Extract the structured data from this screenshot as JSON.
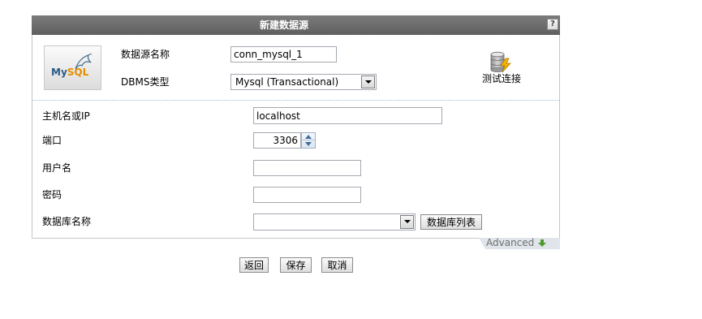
{
  "dialog": {
    "title": "新建数据源",
    "help_label": "?"
  },
  "logo": {
    "text_my": "My",
    "text_sql": "SQL"
  },
  "datasource": {
    "name_label": "数据源名称",
    "name_value": "conn_mysql_1",
    "dbms_label": "DBMS类型",
    "dbms_value": "Mysql (Transactional)",
    "test_connection_label": "测试连接"
  },
  "connection": {
    "host": {
      "label": "主机名或IP",
      "value": "localhost"
    },
    "port": {
      "label": "端口",
      "value": "3306"
    },
    "username": {
      "label": "用户名",
      "value": ""
    },
    "password": {
      "label": "密码",
      "value": ""
    },
    "database": {
      "label": "数据库名称",
      "value": ""
    },
    "database_list_button": "数据库列表"
  },
  "advanced": {
    "label": "Advanced"
  },
  "footer": {
    "back": "返回",
    "save": "保存",
    "cancel": "取消"
  },
  "icons": {
    "help": "help-icon",
    "logo": "mysql-dolphin-icon",
    "dbms_dropdown": "dropdown-arrow-icon",
    "test_connection": "database-test-icon",
    "port_up": "spinner-up-icon",
    "port_down": "spinner-down-icon",
    "database_dropdown": "dropdown-arrow-icon",
    "advanced": "expand-down-icon"
  },
  "colors": {
    "header_bg": "#6b6b6b",
    "header_text": "#ffffff",
    "panel_border": "#c6c6c6",
    "divider": "#a3c0d9",
    "advanced_tab_bg": "#dfe5ea",
    "advanced_arrow": "#4e9a2e",
    "logo_my": "#2b5b84",
    "logo_sql": "#e48e00"
  }
}
